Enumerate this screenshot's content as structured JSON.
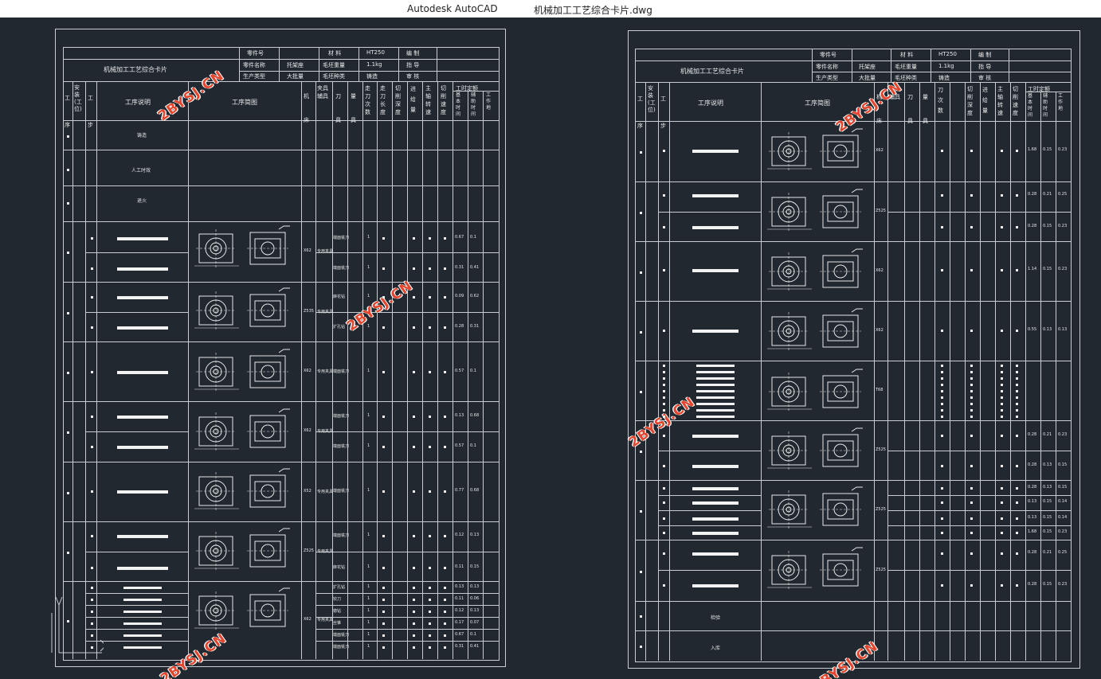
{
  "window": {
    "app_title": "Autodesk AutoCAD",
    "document_title": "机械加工工艺综合卡片.dwg"
  },
  "watermark": "2BYSJ.CN",
  "left_card": {
    "title": "机械加工工艺综合卡片",
    "hdr_part_no": "零件号",
    "hdr_part_name": "零件名称",
    "hdr_prod_type": "生产类型",
    "val_part_name": "托架座",
    "val_prod_type": "大批量",
    "hdr_material": "材 料",
    "hdr_blank_weight": "毛坯重量",
    "hdr_blank_type": "毛坯种类",
    "val_material": "HT250",
    "val_blank_weight": "1.1kg",
    "val_blank_type": "铸造",
    "hdr_prepared": "编 制",
    "hdr_guide": "指 导",
    "hdr_review": "审 核",
    "col_process": "工序",
    "col_setup": "安装(工位)",
    "col_step": "工步",
    "col_desc": "工序说明",
    "col_sketch": "工序简图",
    "col_machine": "机床",
    "col_fixture": "夹具辅具",
    "col_tool": "刀具",
    "col_gauge": "量具",
    "col_passes": "走刀次数",
    "col_length": "走刀长度",
    "col_depth": "切削深度",
    "col_feed": "进给量",
    "col_speed": "主轴转速",
    "col_vel": "切削速度",
    "col_time": "工时定额",
    "col_t_basic": "基本时间",
    "col_t_aux": "辅助时间",
    "col_t_work": "工作地",
    "op1": "铸造",
    "op2": "人工时效",
    "op3": "退火",
    "machines": [
      "X62",
      "Z535",
      "X62",
      "X62",
      "X52",
      "Z525",
      "X62"
    ],
    "fixture_label": "专用夹具",
    "tool_rows": [
      "端面铣刀",
      "端面铣刀",
      "麻花钻",
      "扩孔钻",
      "端面铣刀",
      "端面铣刀",
      "端面铣刀",
      "端面铣刀",
      "端面铣刀",
      "麻花钻",
      "扩孔钻",
      "铰刀",
      "锪钻",
      "丝锥"
    ],
    "passes": [
      "1",
      "1",
      "1",
      "1",
      "1",
      "1",
      "1",
      "1",
      "1",
      "1",
      "1",
      "1",
      "1",
      "1"
    ],
    "t_basic": [
      "0.67",
      "0.31",
      "0.09",
      "0.28",
      "0.57",
      "0.13",
      "0.57",
      "0.77",
      "0.12",
      "0.11",
      "0.13",
      "0.11",
      "0.12",
      "0.17"
    ],
    "t_aux": [
      "0.1",
      "0.41",
      "0.62",
      "0.31",
      "0.1",
      "0.68",
      "0.1",
      "0.68",
      "0.13",
      "0.15",
      "0.13",
      "0.06",
      "0.13",
      "0.07"
    ]
  },
  "right_card": {
    "title": "机械加工工艺综合卡片",
    "hdr_part_no": "零件号",
    "hdr_part_name": "零件名称",
    "hdr_prod_type": "生产类型",
    "val_part_name": "托架座",
    "val_prod_type": "大批量",
    "hdr_material": "材 料",
    "hdr_blank_weight": "毛坯重量",
    "hdr_blank_type": "毛坯种类",
    "val_material": "HT250",
    "val_blank_weight": "1.1kg",
    "val_blank_type": "铸造",
    "hdr_prepared": "编 制",
    "hdr_guide": "指 导",
    "hdr_review": "审 核",
    "col_process": "工序",
    "col_setup": "安装(工位)",
    "col_step": "工步",
    "col_desc": "工序说明",
    "col_sketch": "工序简图",
    "col_machine": "机床",
    "col_fixture": "夹具辅具",
    "col_tool": "刀具",
    "col_gauge": "量具",
    "col_passes": "刀次数",
    "col_depth": "切削深度",
    "col_feed": "进给量",
    "col_speed": "主轴转速",
    "col_vel": "切削速度",
    "col_time": "工时定额",
    "col_t_basic": "基本时间",
    "col_t_aux": "辅助时间",
    "col_t_work": "工作地",
    "machines": [
      "X62",
      "Z525",
      "X62",
      "X62",
      "T68",
      "Z525",
      "Z525",
      "Z525"
    ],
    "op_last1": "检验",
    "op_last2": "入库",
    "t_basic": [
      "1.68",
      "0.28",
      "0.28",
      "1.14",
      "0.55",
      "0.28",
      "0.28",
      "0.28",
      "0.13",
      "0.13"
    ],
    "t_aux": [
      "0.15",
      "0.21",
      "0.15",
      "0.15",
      "0.13",
      "0.21",
      "0.13",
      "0.13",
      "0.15",
      "0.15"
    ],
    "t_work": [
      "0.23",
      "0.25",
      "0.23",
      "0.23",
      "0.13",
      "0.23",
      "0.15",
      "0.15",
      "0.14",
      "0.14"
    ]
  }
}
